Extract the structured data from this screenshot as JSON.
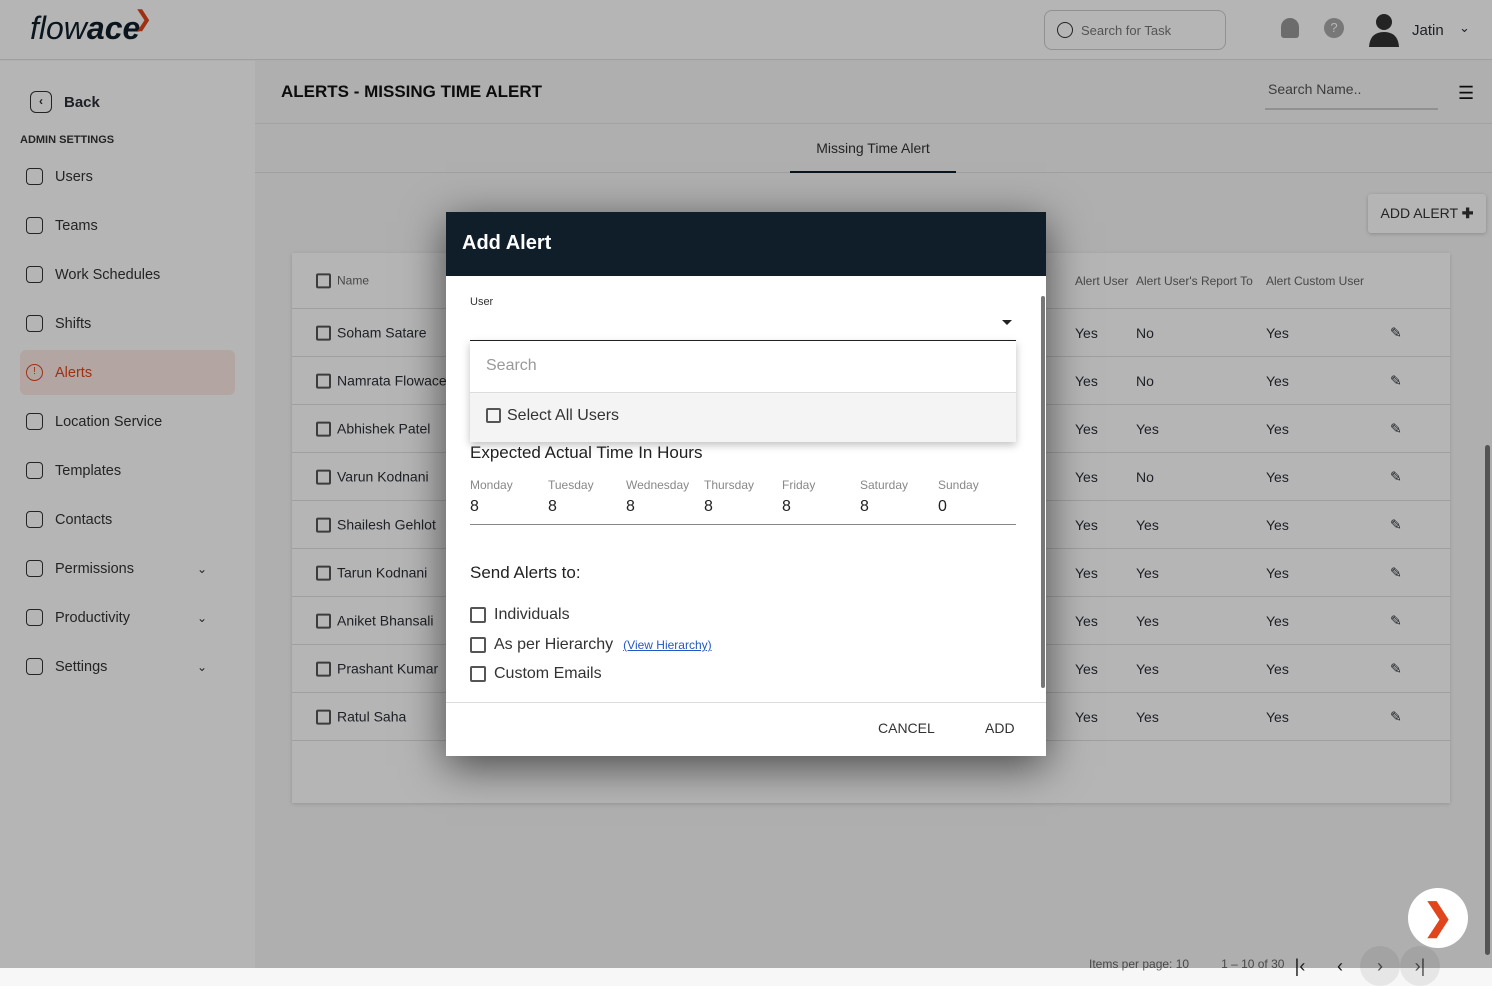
{
  "brand": {
    "logo_light": "flow",
    "logo_bold": "ace",
    "accent": "#e0451b",
    "dark": "#0f1e29"
  },
  "topbar": {
    "search_placeholder": "Search for Task",
    "user_name": "Jatin",
    "help": "?"
  },
  "sidebar": {
    "back": "Back",
    "section": "ADMIN SETTINGS",
    "items": [
      {
        "label": "Users",
        "icon": "user-icon",
        "active": false
      },
      {
        "label": "Teams",
        "icon": "team-icon",
        "active": false
      },
      {
        "label": "Work Schedules",
        "icon": "calendar-icon",
        "active": false
      },
      {
        "label": "Shifts",
        "icon": "shift-icon",
        "active": false
      },
      {
        "label": "Alerts",
        "icon": "alert-icon",
        "active": true
      },
      {
        "label": "Location Service",
        "icon": "map-icon",
        "active": false
      },
      {
        "label": "Templates",
        "icon": "folder-icon",
        "active": false
      },
      {
        "label": "Contacts",
        "icon": "contact-icon",
        "active": false
      },
      {
        "label": "Permissions",
        "icon": "lock-icon",
        "active": false,
        "expandable": true
      },
      {
        "label": "Productivity",
        "icon": "chart-icon",
        "active": false,
        "expandable": true
      },
      {
        "label": "Settings",
        "icon": "gear-icon",
        "active": false,
        "expandable": true
      }
    ]
  },
  "main": {
    "title": "ALERTS - MISSING TIME ALERT",
    "search_name_placeholder": "Search Name..",
    "tab": "Missing Time Alert",
    "add_alert": "ADD ALERT"
  },
  "table": {
    "headers": {
      "name": "Name",
      "alert_user": "Alert User",
      "report_to": "Alert User's Report To",
      "custom": "Alert Custom User"
    },
    "rows": [
      {
        "name": "Soham Satare",
        "alert_user": "Yes",
        "report_to": "No",
        "custom": "Yes"
      },
      {
        "name": "Namrata Flowace",
        "alert_user": "Yes",
        "report_to": "No",
        "custom": "Yes"
      },
      {
        "name": "Abhishek Patel",
        "alert_user": "Yes",
        "report_to": "Yes",
        "custom": "Yes"
      },
      {
        "name": "Varun Kodnani",
        "alert_user": "Yes",
        "report_to": "No",
        "custom": "Yes"
      },
      {
        "name": "Shailesh Gehlot",
        "alert_user": "Yes",
        "report_to": "Yes",
        "custom": "Yes"
      },
      {
        "name": "Tarun Kodnani",
        "alert_user": "Yes",
        "report_to": "Yes",
        "custom": "Yes"
      },
      {
        "name": "Aniket Bhansali",
        "alert_user": "Yes",
        "report_to": "Yes",
        "custom": "Yes"
      },
      {
        "name": "Prashant Kumar",
        "alert_user": "Yes",
        "report_to": "Yes",
        "custom": "Yes"
      },
      {
        "name": "Ratul Saha",
        "alert_user": "Yes",
        "report_to": "Yes",
        "custom": "Yes"
      }
    ],
    "items_per_page": "Items per page: 10",
    "range": "1 – 10 of 30"
  },
  "modal": {
    "title": "Add Alert",
    "user_label": "User",
    "search_placeholder": "Search",
    "select_all": "Select All Users",
    "expected_title": "Expected Actual Time In Hours",
    "days": [
      {
        "label": "Monday",
        "value": "8"
      },
      {
        "label": "Tuesday",
        "value": "8"
      },
      {
        "label": "Wednesday",
        "value": "8"
      },
      {
        "label": "Thursday",
        "value": "8"
      },
      {
        "label": "Friday",
        "value": "8"
      },
      {
        "label": "Saturday",
        "value": "8"
      },
      {
        "label": "Sunday",
        "value": "0"
      }
    ],
    "send_title": "Send Alerts to:",
    "options": [
      "Individuals",
      "As per Hierarchy",
      "Custom Emails"
    ],
    "view_hierarchy": "(View Hierarchy)",
    "cancel": "CANCEL",
    "add": "ADD"
  }
}
